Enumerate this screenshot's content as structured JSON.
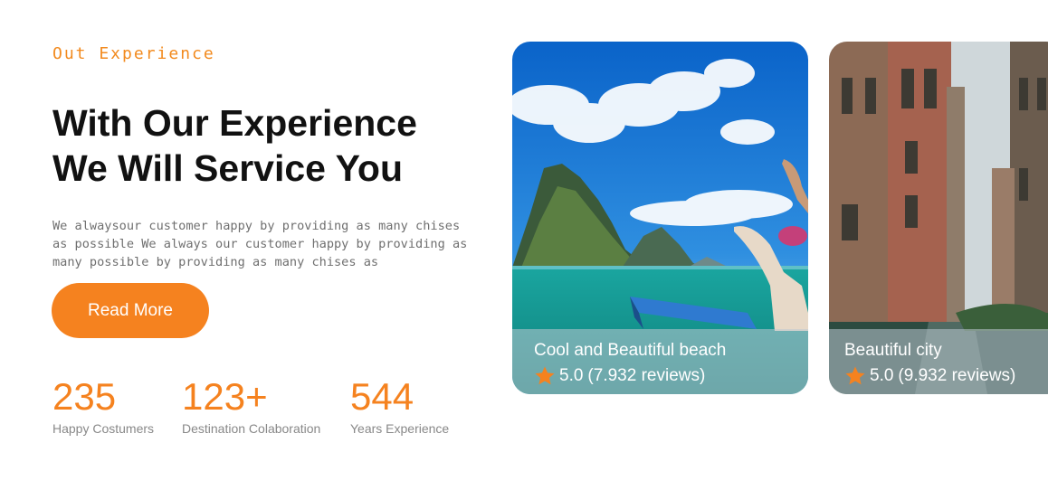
{
  "section": {
    "eyebrow": "Out Experience",
    "headline_line1": "With Our Experience",
    "headline_line2": "We Will Service You",
    "description": "We alwaysour customer happy by providing as many chises as possible We always our customer happy by providing as many possible by providing as many chises as",
    "read_more_label": "Read More"
  },
  "stats": [
    {
      "value": "235",
      "label": "Happy Costumers"
    },
    {
      "value": "123+",
      "label": "Destination Colaboration"
    },
    {
      "value": "544",
      "label": "Years Experience"
    }
  ],
  "cards": [
    {
      "title": "Cool and Beautiful beach",
      "rating": "5.0",
      "reviews": "(7.932 reviews)",
      "icon": "star-icon"
    },
    {
      "title": "Beautiful city",
      "rating": "5.0",
      "reviews": "(9.932 reviews)",
      "icon": "star-icon"
    }
  ],
  "colors": {
    "accent": "#f5821f",
    "heading": "#111111",
    "muted": "#888888"
  }
}
